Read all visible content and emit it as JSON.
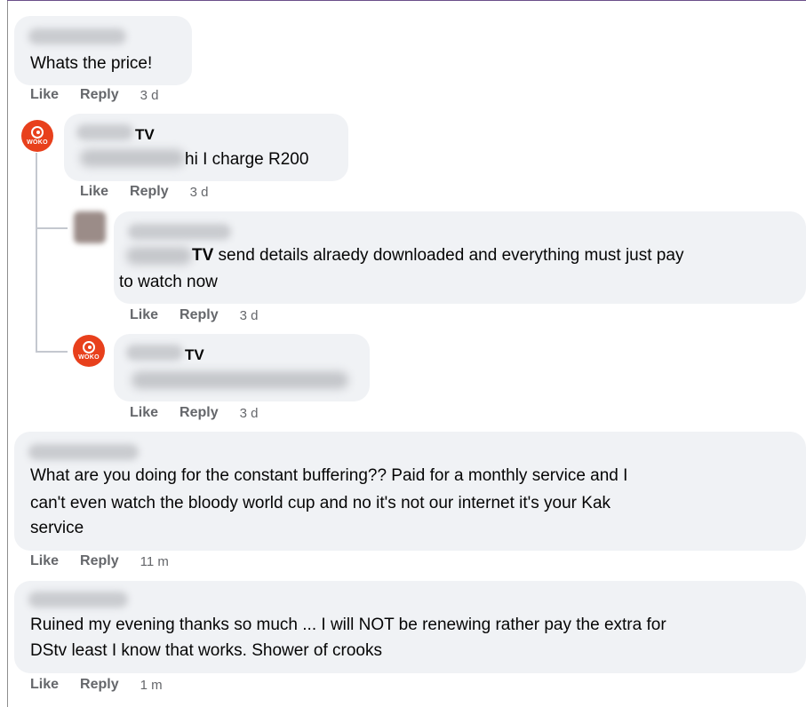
{
  "comments": [
    {
      "id": "c1",
      "text": "Whats the price!",
      "actions": {
        "like": "Like",
        "reply": "Reply",
        "time": "3 d"
      }
    },
    {
      "id": "r1",
      "author_suffix": "TV",
      "text": "hi I charge R200",
      "avatar_label": "WOKO",
      "actions": {
        "like": "Like",
        "reply": "Reply",
        "time": "3 d"
      }
    },
    {
      "id": "r2",
      "tag_suffix": "TV",
      "text_line1": " send details alraedy downloaded and everything must just pay",
      "text_line2": "to watch now",
      "actions": {
        "like": "Like",
        "reply": "Reply",
        "time": "3 d"
      }
    },
    {
      "id": "r3",
      "author_suffix": "TV",
      "avatar_label": "WOKO",
      "actions": {
        "like": "Like",
        "reply": "Reply",
        "time": "3 d"
      }
    },
    {
      "id": "c2",
      "lines": [
        "What are you doing for the constant buffering?? Paid for a monthly service and I",
        "can't even watch the bloody world cup and no it's not our internet it's your Kak",
        "service"
      ],
      "actions": {
        "like": "Like",
        "reply": "Reply",
        "time": "11 m"
      }
    },
    {
      "id": "c3",
      "lines": [
        "Ruined my evening thanks so much ... I will NOT be renewing rather pay the extra for",
        "DStv least I know that works. Shower of crooks"
      ],
      "actions": {
        "like": "Like",
        "reply": "Reply",
        "time": "1 m"
      }
    }
  ],
  "colors": {
    "bubble": "#f0f2f5",
    "muted": "#65676b",
    "brand": "#e8401c"
  }
}
